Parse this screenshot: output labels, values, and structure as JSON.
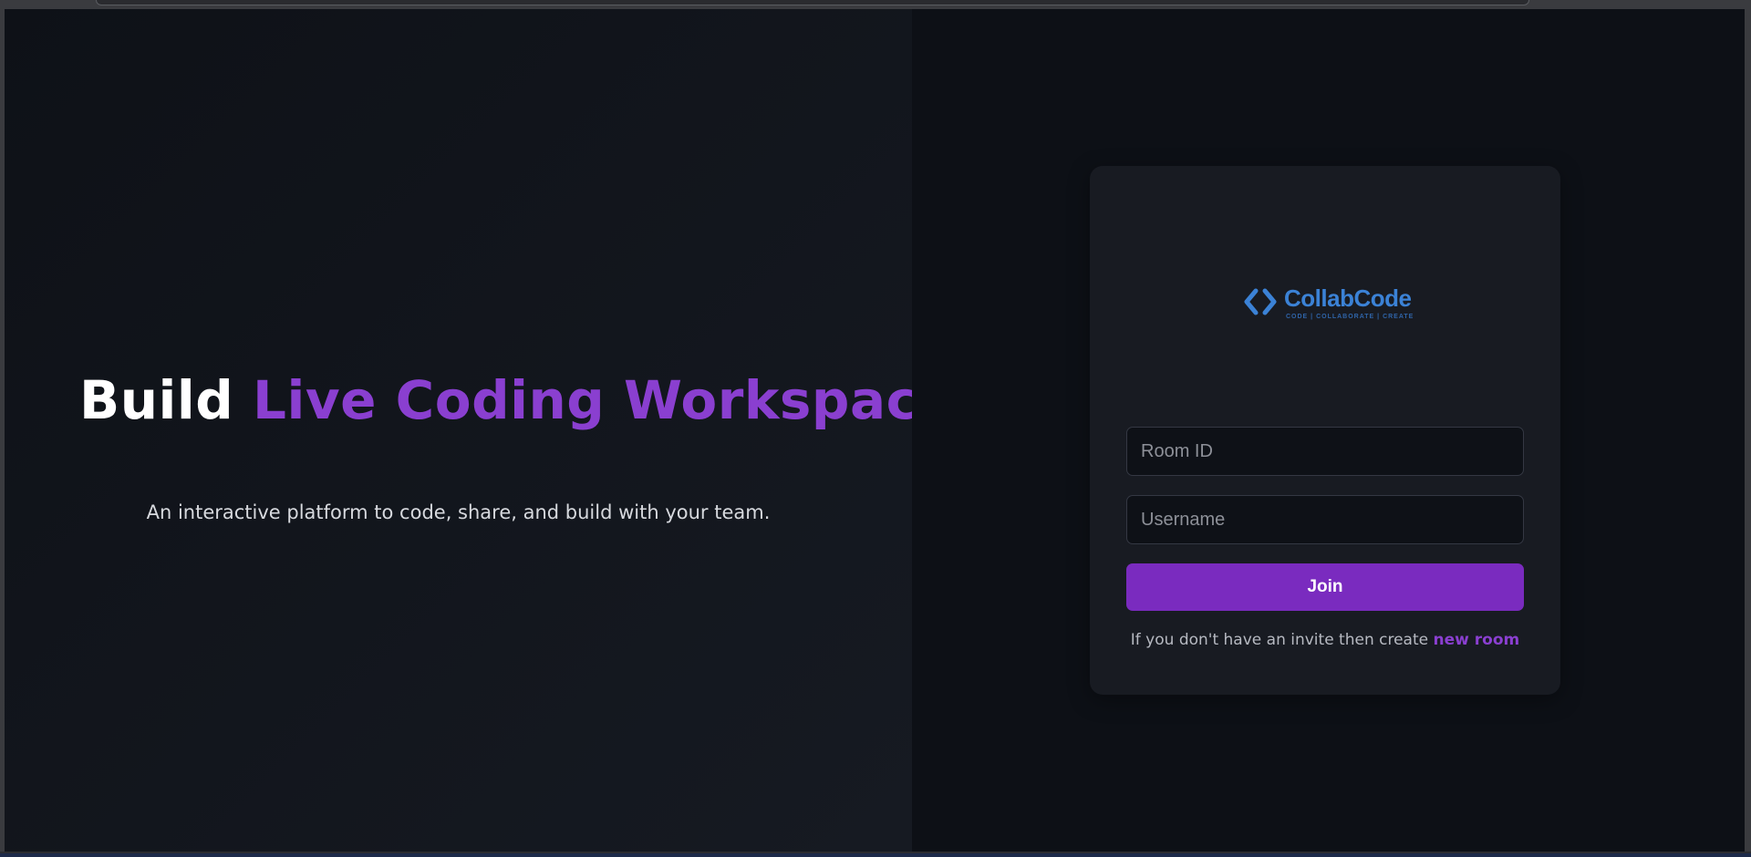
{
  "hero": {
    "title_lead": "Build ",
    "title_accent": "Live Coding Workspaces",
    "subtitle": "An interactive platform to code, share, and build with your team."
  },
  "logo": {
    "icon": "code-brackets-icon",
    "name": "CollabCode",
    "tagline": "CODE | COLLABORATE | CREATE"
  },
  "form": {
    "room_placeholder": "Room ID",
    "room_value": "",
    "username_placeholder": "Username",
    "username_value": "",
    "join_label": "Join",
    "invite_prefix": "If you don't have an invite then create ",
    "invite_link": "new room"
  },
  "colors": {
    "accent": "#8a3fd0",
    "button": "#7a2bbf",
    "logo": "#3b82d6",
    "background": "#0e1117",
    "card": "#181b22"
  }
}
